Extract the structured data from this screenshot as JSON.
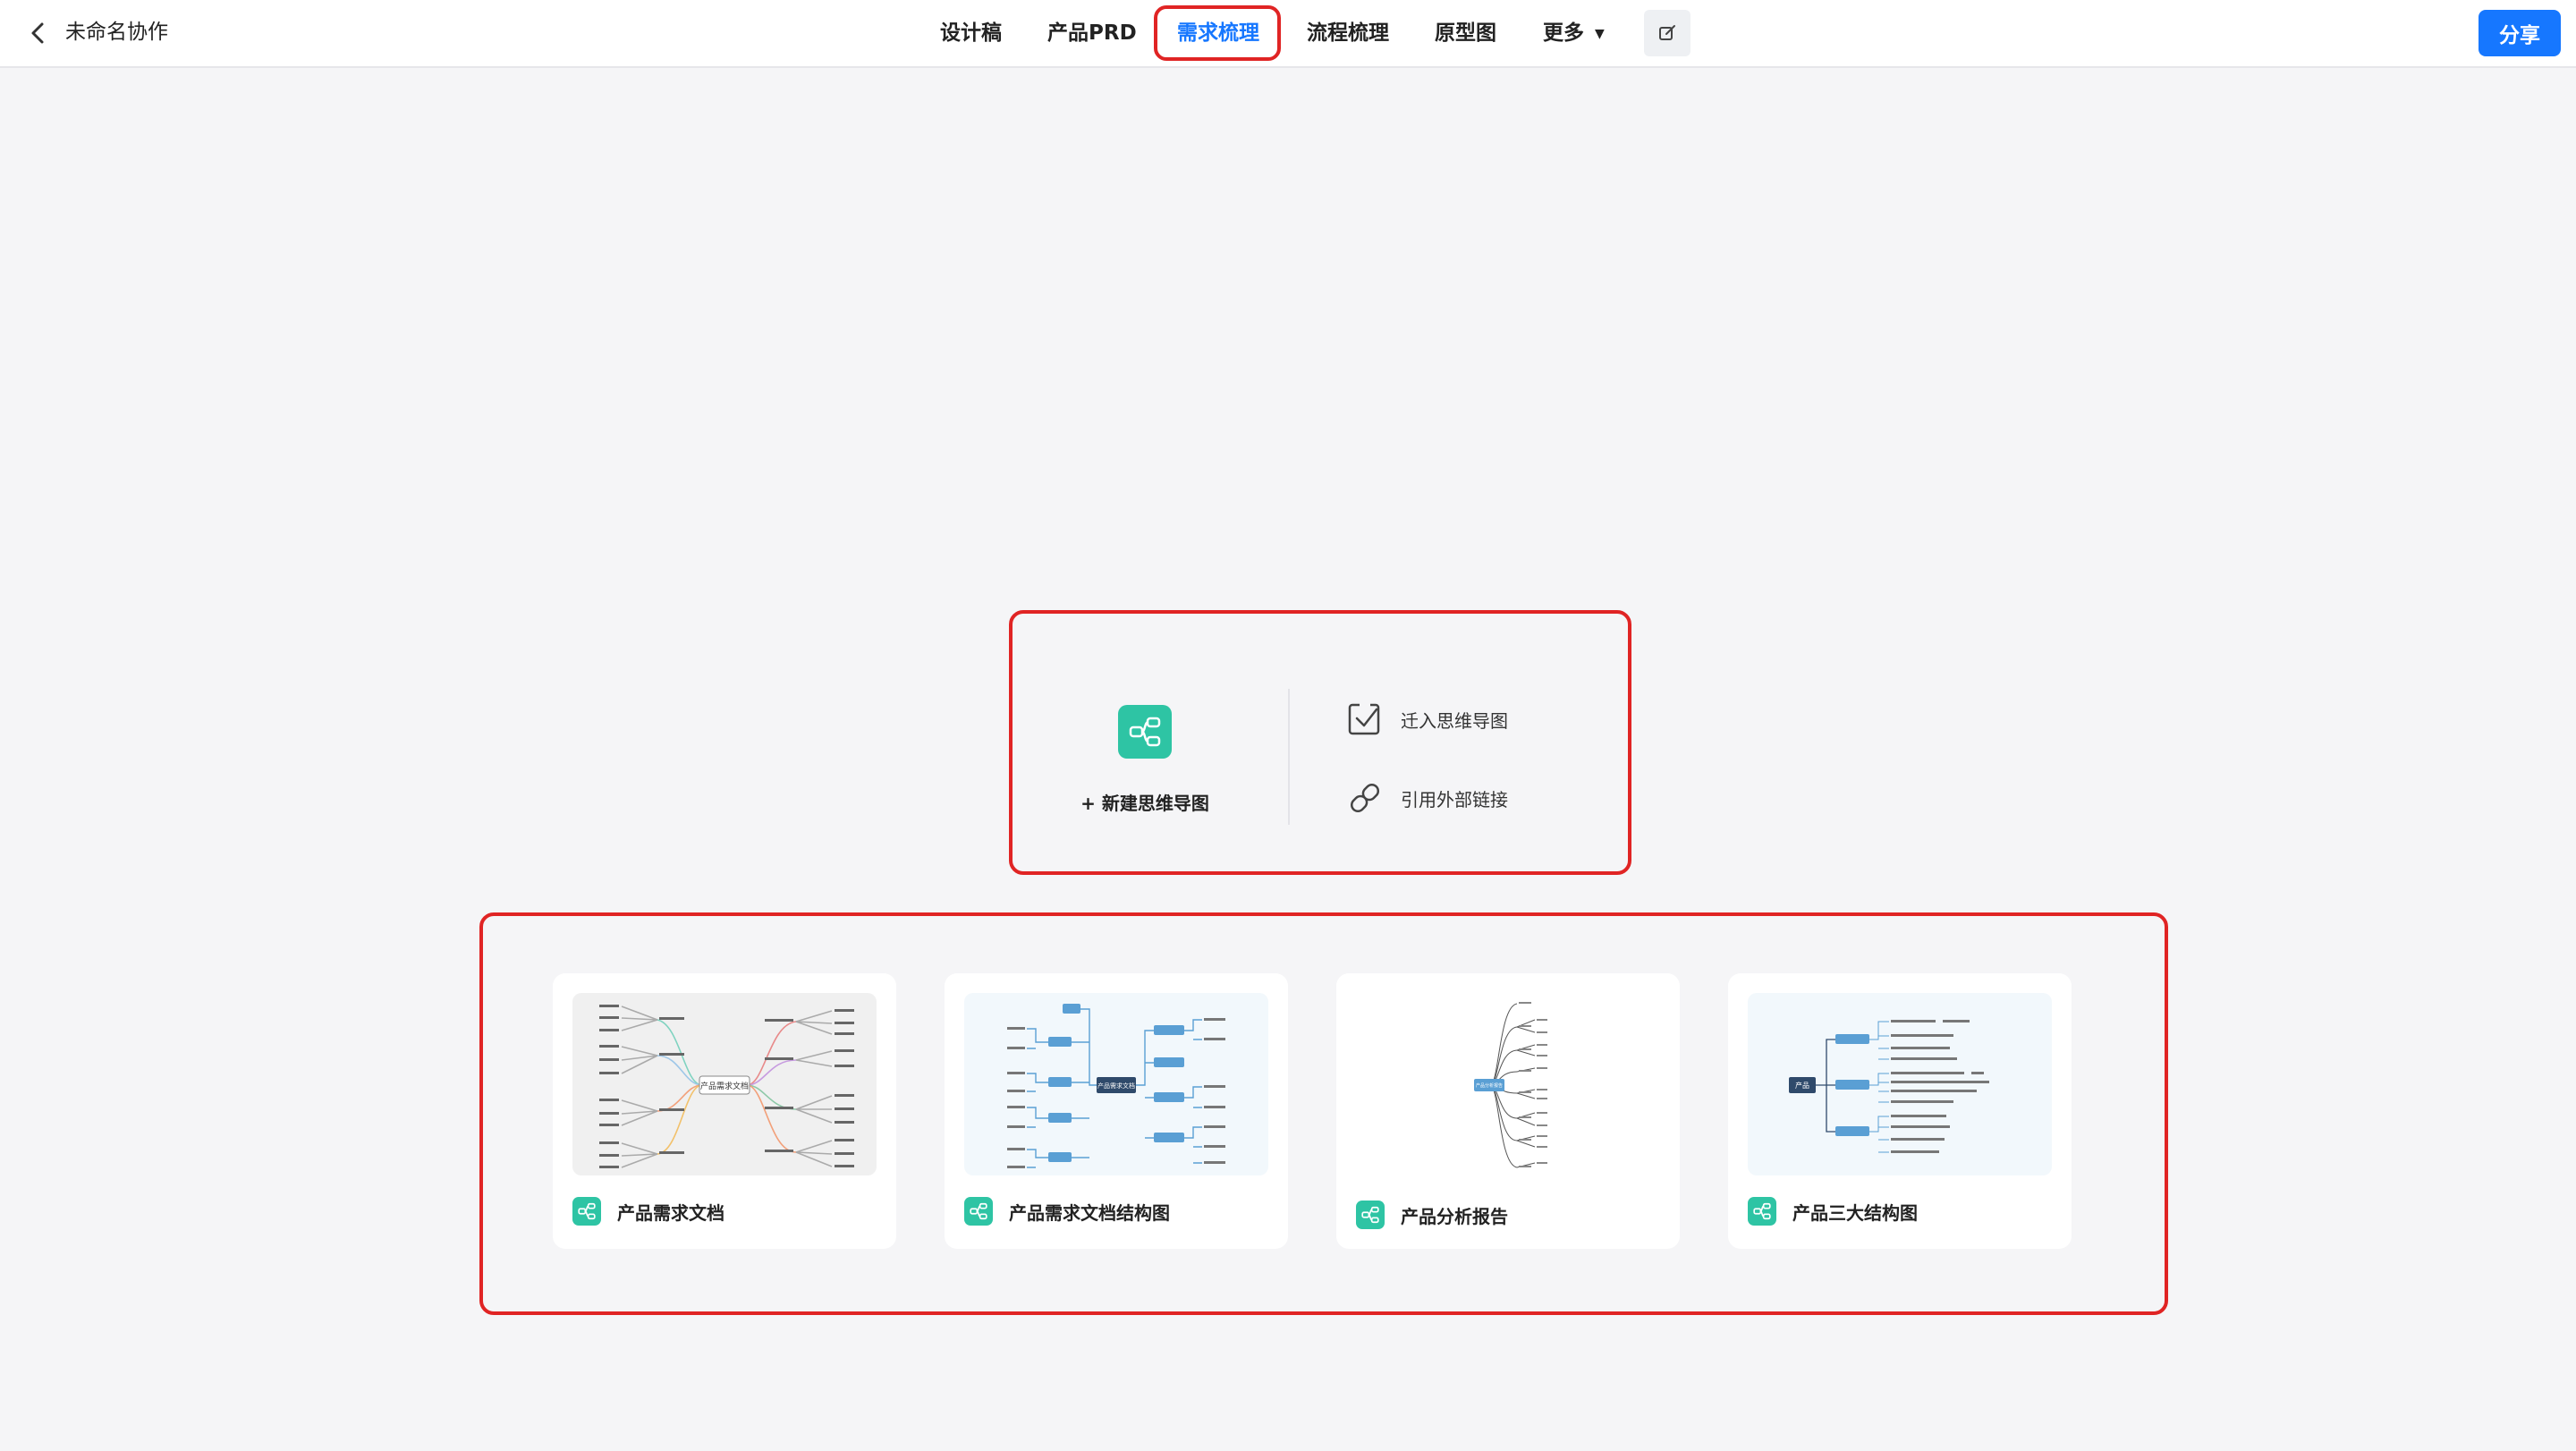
{
  "header": {
    "doc_title": "未命名协作",
    "tabs": [
      {
        "label": "设计稿",
        "active": false
      },
      {
        "label": "产品PRD",
        "active": false
      },
      {
        "label": "需求梳理",
        "active": true
      },
      {
        "label": "流程梳理",
        "active": false
      },
      {
        "label": "原型图",
        "active": false
      },
      {
        "label": "更多",
        "active": false
      }
    ],
    "share_label": "分享"
  },
  "actions": {
    "new_label": "+ 新建思维导图",
    "import_label": "迁入思维导图",
    "link_label": "引用外部链接"
  },
  "templates": [
    {
      "title": "产品需求文档",
      "center": "产品需求文档"
    },
    {
      "title": "产品需求文档结构图",
      "center": "产品需求文档"
    },
    {
      "title": "产品分析报告",
      "center": "产品分析报告"
    },
    {
      "title": "产品三大结构图",
      "center": "产品"
    }
  ],
  "colors": {
    "accent": "#1677ff",
    "mindmap_green": "#2ec4a4",
    "highlight_red": "#e02424",
    "background": "#f5f5f7"
  },
  "icons": [
    "back-arrow-icon",
    "caret-down-icon",
    "edit-icon",
    "mindmap-icon",
    "import-icon",
    "link-icon"
  ]
}
